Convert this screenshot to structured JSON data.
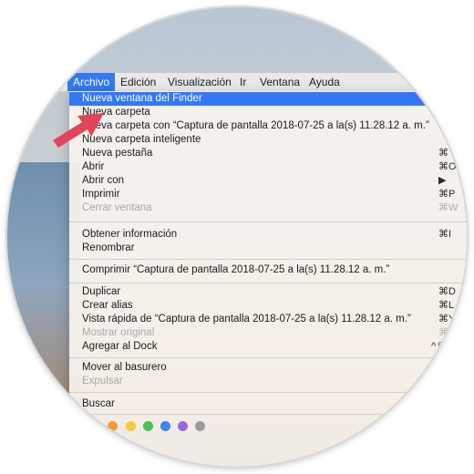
{
  "menubar": {
    "items": [
      {
        "label": "Archivo"
      },
      {
        "label": "Edición"
      },
      {
        "label": "Visualización"
      },
      {
        "label": "Ir"
      },
      {
        "label": "Ventana"
      },
      {
        "label": "Ayuda"
      }
    ]
  },
  "menu": {
    "items": [
      {
        "label": "Nueva ventana del Finder",
        "shortcut": ""
      },
      {
        "label": "Nueva carpeta",
        "shortcut": ""
      },
      {
        "label": "Nueva carpeta con “Captura de pantalla 2018-07-25 a la(s) 11.28.12 a. m.”",
        "shortcut": "^"
      },
      {
        "label": "Nueva carpeta inteligente",
        "shortcut": ""
      },
      {
        "label": "Nueva pestaña",
        "shortcut": "⌘"
      },
      {
        "label": "Abrir",
        "shortcut": "⌘O"
      },
      {
        "label": "Abrir con",
        "shortcut": "▶"
      },
      {
        "label": "Imprimir",
        "shortcut": "⌘P"
      },
      {
        "label": "Cerrar ventana",
        "shortcut": "⌘W"
      },
      {
        "label": "Obtener información",
        "shortcut": "⌘I"
      },
      {
        "label": "Renombrar",
        "shortcut": ""
      },
      {
        "label": "Comprimir “Captura de pantalla 2018-07-25 a la(s) 11.28.12 a. m.”",
        "shortcut": ""
      },
      {
        "label": "Duplicar",
        "shortcut": "⌘D"
      },
      {
        "label": "Crear alias",
        "shortcut": "⌘L"
      },
      {
        "label": "Vista rápida de “Captura de pantalla 2018-07-25 a la(s) 11.28.12 a. m.”",
        "shortcut": "⌘Y"
      },
      {
        "label": "Mostrar original",
        "shortcut": "⌘R"
      },
      {
        "label": "Agregar al Dock",
        "shortcut": "^⇧⌘T"
      },
      {
        "label": "Mover al basurero",
        "shortcut": ""
      },
      {
        "label": "Expulsar",
        "shortcut": ""
      },
      {
        "label": "Buscar",
        "shortcut": ""
      }
    ],
    "highlighted_index": 0,
    "disabled": [
      "Cerrar ventana",
      "Mostrar original",
      "Expulsar"
    ]
  },
  "tags": {
    "colors": [
      "#f39a3a",
      "#f5c93b",
      "#4cc24e",
      "#3d86f0",
      "#9a67d8",
      "#9a9a9a"
    ]
  },
  "colors": {
    "accent": "#3478f6",
    "arrow": "#e0455a"
  }
}
